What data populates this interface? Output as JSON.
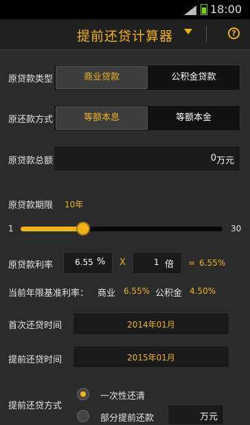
{
  "status": {
    "time": "18:00"
  },
  "header": {
    "title": "提前还贷计算器",
    "help_label": "?"
  },
  "loan_type": {
    "label": "原贷款类型",
    "options": [
      "商业贷款",
      "公积金贷款"
    ],
    "selected": "商业贷款"
  },
  "repay_method": {
    "label": "原还款方式",
    "options": [
      "等额本息",
      "等额本金"
    ],
    "selected": "等额本息"
  },
  "loan_amount": {
    "label": "原贷款总额",
    "value": "0",
    "unit": "万元"
  },
  "term": {
    "label": "原贷款期限",
    "value": "10年",
    "min": "1",
    "max": "30",
    "level": 10
  },
  "rate": {
    "label": "原贷款利率",
    "base": "6.55",
    "base_unit": "%",
    "times_sign": "X",
    "multiplier": "1",
    "multiplier_unit": "倍",
    "equals": "=",
    "result": "6.55%"
  },
  "benchmark": {
    "label": "当前年限基准利率：",
    "commercial_label": "商业",
    "commercial_rate": "6.55%",
    "fund_label": "公积金",
    "fund_rate": "4.50%"
  },
  "first_repay": {
    "label": "首次还贷时间",
    "value": "2014年01月"
  },
  "early_repay": {
    "label": "提前还贷时间",
    "value": "2015年01月"
  },
  "prepay_method": {
    "label": "提前还贷方式",
    "options": [
      "一次性还清",
      "部分提前还款"
    ],
    "selected": "一次性还清",
    "partial_unit": "万元"
  },
  "colors": {
    "accent": "#f0b31d",
    "background": "#2b2b2b"
  }
}
